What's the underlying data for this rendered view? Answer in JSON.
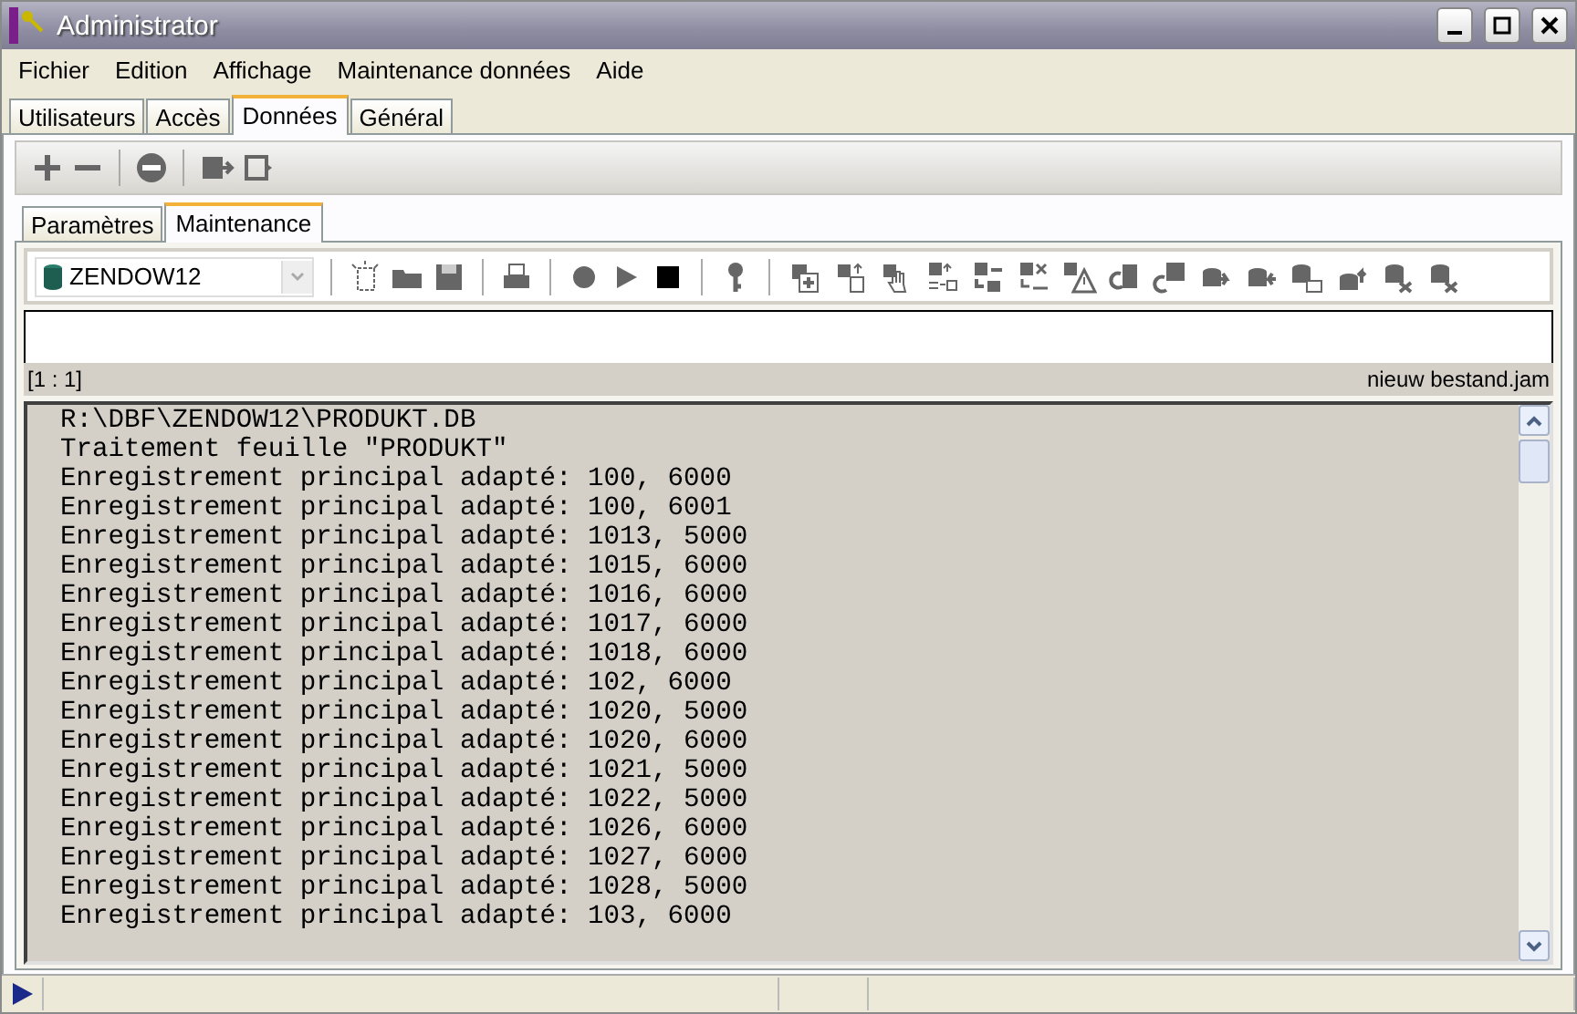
{
  "window": {
    "title": "Administrator"
  },
  "menu": [
    "Fichier",
    "Edition",
    "Affichage",
    "Maintenance données",
    "Aide"
  ],
  "tabs": [
    {
      "label": "Utilisateurs",
      "selected": false
    },
    {
      "label": "Accès",
      "selected": false
    },
    {
      "label": "Données",
      "selected": true
    },
    {
      "label": "Général",
      "selected": false
    }
  ],
  "subtabs": [
    {
      "label": "Paramètres",
      "selected": false
    },
    {
      "label": "Maintenance",
      "selected": true
    }
  ],
  "database_select": {
    "value": "ZENDOW12"
  },
  "editor": {
    "position": "[1 : 1]",
    "file": "nieuw bestand.jam"
  },
  "log": [
    "R:\\DBF\\ZENDOW12\\PRODUKT.DB",
    "Traitement feuille \"PRODUKT\"",
    "Enregistrement principal adapté: 100, 6000",
    "Enregistrement principal adapté: 100, 6001",
    "Enregistrement principal adapté: 1013, 5000",
    "Enregistrement principal adapté: 1015, 6000",
    "Enregistrement principal adapté: 1016, 6000",
    "Enregistrement principal adapté: 1017, 6000",
    "Enregistrement principal adapté: 1018, 6000",
    "Enregistrement principal adapté: 102, 6000",
    "Enregistrement principal adapté: 1020, 5000",
    "Enregistrement principal adapté: 1020, 6000",
    "Enregistrement principal adapté: 1021, 5000",
    "Enregistrement principal adapté: 1022, 5000",
    "Enregistrement principal adapté: 1026, 6000",
    "Enregistrement principal adapté: 1027, 6000",
    "Enregistrement principal adapté: 1028, 5000",
    "Enregistrement principal adapté: 103, 6000"
  ]
}
